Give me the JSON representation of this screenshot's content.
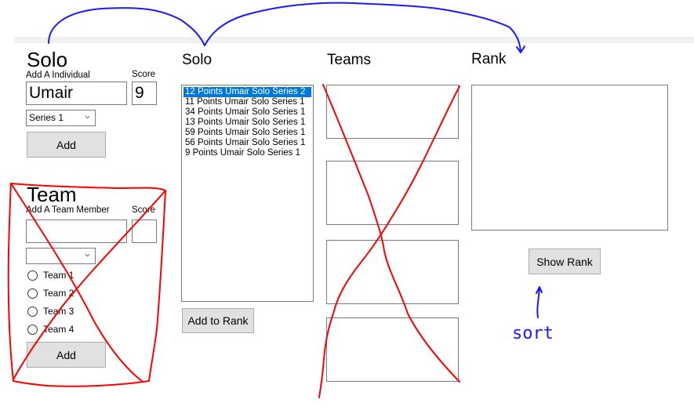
{
  "solo_entry": {
    "title": "Solo",
    "name_label": "Add A Individual",
    "score_label": "Score",
    "name_value": "Umair",
    "score_value": "9",
    "series_selected": "Series 1",
    "add_button": "Add"
  },
  "team_entry": {
    "title": "Team",
    "name_label": "Add A Team Member",
    "score_label": "Score",
    "name_value": "",
    "score_value": "",
    "series_selected": "",
    "teams": [
      {
        "label": "Team 1",
        "checked": false
      },
      {
        "label": "Team 2",
        "checked": false
      },
      {
        "label": "Team 3",
        "checked": false
      },
      {
        "label": "Team 4",
        "checked": false
      }
    ],
    "add_button": "Add"
  },
  "solo_list": {
    "title": "Solo",
    "items": [
      {
        "text": "12 Points Umair Solo Series 2",
        "selected": true
      },
      {
        "text": "11 Points Umair Solo Series 1",
        "selected": false
      },
      {
        "text": "34 Points Umair Solo Series 1",
        "selected": false
      },
      {
        "text": "13 Points Umair Solo Series 1",
        "selected": false
      },
      {
        "text": "59 Points Umair Solo Series 1",
        "selected": false
      },
      {
        "text": "56 Points Umair Solo Series 1",
        "selected": false
      },
      {
        "text": "9 Points Umair Solo Series 1",
        "selected": false
      }
    ],
    "add_to_rank_button": "Add to Rank"
  },
  "teams_list": {
    "title": "Teams",
    "panels": 4
  },
  "rank": {
    "title": "Rank",
    "show_rank_button": "Show Rank"
  },
  "annotations": {
    "sort_note": "sort",
    "pen_blue": "#1a1aff",
    "pen_red": "#ff0000"
  }
}
